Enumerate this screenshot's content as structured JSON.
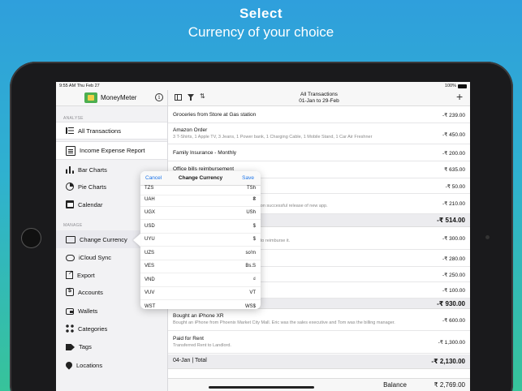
{
  "promo": {
    "headline": "Select",
    "subline": "Currency of your choice"
  },
  "status": {
    "time": "9:55 AM  Thu Feb 27",
    "battery": "100%"
  },
  "sidebar": {
    "app_name": "MoneyMeter",
    "analyse_label": "ANALYSE",
    "manage_label": "MANAGE",
    "analyse_items": [
      {
        "label": "All Transactions",
        "icon": "list-icon"
      },
      {
        "label": "Income Expense Report",
        "icon": "report-icon"
      },
      {
        "label": "Bar Charts",
        "icon": "bar-chart-icon"
      },
      {
        "label": "Pie Charts",
        "icon": "pie-chart-icon"
      },
      {
        "label": "Calendar",
        "icon": "calendar-icon"
      }
    ],
    "manage_items": [
      {
        "label": "Change Currency",
        "icon": "currency-icon"
      },
      {
        "label": "iCloud Sync",
        "icon": "cloud-icon"
      },
      {
        "label": "Export",
        "icon": "export-icon"
      },
      {
        "label": "Accounts",
        "icon": "accounts-icon"
      },
      {
        "label": "Wallets",
        "icon": "wallet-icon"
      },
      {
        "label": "Categories",
        "icon": "categories-icon"
      },
      {
        "label": "Tags",
        "icon": "tag-icon"
      },
      {
        "label": "Locations",
        "icon": "location-icon"
      }
    ]
  },
  "main": {
    "title": "All Transactions",
    "date_range": "01-Jan to 29-Feb",
    "transactions": [
      {
        "name": "Groceries from Store at Gas station",
        "desc": "",
        "amount": "-₹ 239.00"
      },
      {
        "name": "Amazon Order",
        "desc": "3 T-Shirts, 1 Apple TV, 3 Jeans, 1 Power bank, 1 Charging Cable, 1 Mobile Stand, 1 Car Air Freshner",
        "amount": "-₹ 450.00"
      },
      {
        "name": "Family Insurance  - Monthly",
        "desc": "",
        "amount": "-₹ 200.00"
      },
      {
        "name": "Office bills reimbursement",
        "desc": "",
        "amount": "₹ 635.00"
      },
      {
        "name": "",
        "desc": "",
        "amount": "-₹ 50.00"
      },
      {
        "name": "",
        "desc": "rty upon successful release of new app.",
        "amount": "-₹ 210.00"
      }
    ],
    "subtotal_1": "-₹ 514.00",
    "transactions_2": [
      {
        "name": "",
        "desc": "need to reimburse it.",
        "amount": "-₹ 300.00"
      },
      {
        "name": "",
        "desc": "",
        "amount": "-₹ 280.00"
      },
      {
        "name": "",
        "desc": "",
        "amount": "-₹ 250.00"
      },
      {
        "name": "",
        "desc": "",
        "amount": "-₹ 100.00"
      }
    ],
    "subtotal_2": "-₹ 930.00",
    "transactions_3": [
      {
        "name": "Bought an iPhone XR",
        "desc": "Bought an iPhone from Phoenix Market City Mall. Eric was the sales executive and Tom was the billing manager.",
        "amount": "-₹ 600.00"
      },
      {
        "name": "Paid for Rent",
        "desc": "Transferred Rent to Landlord.",
        "amount": "-₹ 1,300.00"
      }
    ],
    "day_total_label": "04-Jan | Total",
    "day_total_amount": "-₹ 2,130.00",
    "balance_label": "Balance",
    "balance_amount": "₹ 2,769.00"
  },
  "popover": {
    "cancel": "Cancel",
    "title": "Change Currency",
    "save": "Save",
    "currencies": [
      {
        "code": "TZS",
        "symbol": "TSh"
      },
      {
        "code": "UAH",
        "symbol": "₴"
      },
      {
        "code": "UGX",
        "symbol": "USh"
      },
      {
        "code": "USD",
        "symbol": "$"
      },
      {
        "code": "UYU",
        "symbol": "$"
      },
      {
        "code": "UZS",
        "symbol": "so'm"
      },
      {
        "code": "VES",
        "symbol": "Bs.S"
      },
      {
        "code": "VND",
        "symbol": "₫"
      },
      {
        "code": "VUV",
        "symbol": "VT"
      },
      {
        "code": "WST",
        "symbol": "WS$"
      }
    ]
  }
}
